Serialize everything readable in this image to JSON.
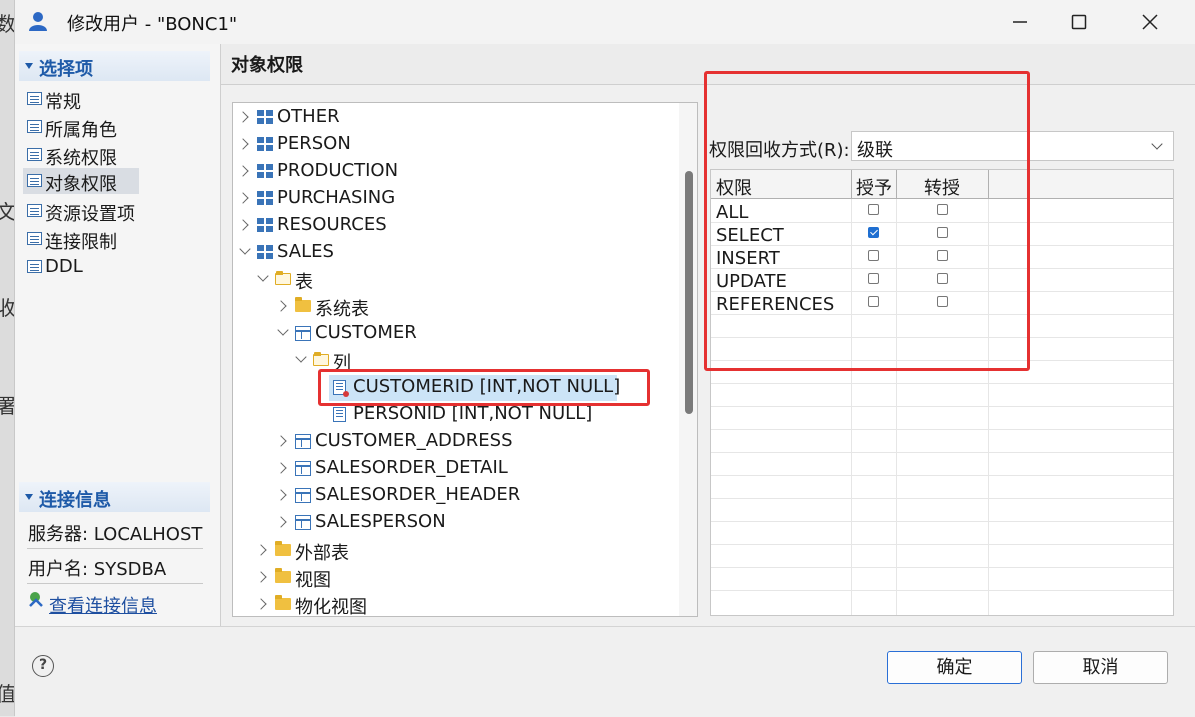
{
  "backdrop": {
    "glyphs": [
      "数",
      "文",
      "收",
      "署",
      "值"
    ]
  },
  "window": {
    "title": "修改用户 - \"BONC1\"",
    "minimize": "—",
    "maximize": "☐",
    "close": "✕"
  },
  "nav": {
    "section_title": "选择项",
    "items": [
      {
        "label": "常规"
      },
      {
        "label": "所属角色"
      },
      {
        "label": "系统权限"
      },
      {
        "label": "对象权限"
      },
      {
        "label": "资源设置项"
      },
      {
        "label": "连接限制"
      },
      {
        "label": "DDL"
      }
    ],
    "selected_index": 3,
    "conn_title": "连接信息",
    "server": "服务器: LOCALHOST",
    "username": "用户名: SYSDBA",
    "view_conn": "查看连接信息"
  },
  "main": {
    "title": "对象权限"
  },
  "tree": {
    "rows": [
      {
        "label": "OTHER",
        "icon": "schema-icon"
      },
      {
        "label": "PERSON",
        "icon": "schema-icon"
      },
      {
        "label": "PRODUCTION",
        "icon": "schema-icon"
      },
      {
        "label": "PURCHASING",
        "icon": "schema-icon"
      },
      {
        "label": "RESOURCES",
        "icon": "schema-icon"
      },
      {
        "label": "SALES",
        "icon": "schema-icon"
      },
      {
        "label": "表",
        "icon": "folder-open-icon"
      },
      {
        "label": "系统表",
        "icon": "folder-icon"
      },
      {
        "label": "CUSTOMER",
        "icon": "table-icon"
      },
      {
        "label": "列",
        "icon": "folder-open-icon"
      },
      {
        "label": "CUSTOMERID [INT,NOT NULL]",
        "icon": "key-column-icon"
      },
      {
        "label": "PERSONID [INT,NOT NULL]",
        "icon": "column-icon"
      },
      {
        "label": "CUSTOMER_ADDRESS",
        "icon": "table-icon"
      },
      {
        "label": "SALESORDER_DETAIL",
        "icon": "table-icon"
      },
      {
        "label": "SALESORDER_HEADER",
        "icon": "table-icon"
      },
      {
        "label": "SALESPERSON",
        "icon": "table-icon"
      },
      {
        "label": "外部表",
        "icon": "folder-icon"
      },
      {
        "label": "视图",
        "icon": "folder-icon"
      },
      {
        "label": "物化视图",
        "icon": "folder-icon"
      }
    ],
    "selected_index": 10
  },
  "revoke": {
    "label": "权限回收方式(R):",
    "mnemonic": "R",
    "value": "级联"
  },
  "grid": {
    "columns": [
      "权限",
      "授予",
      "转授"
    ],
    "rows": [
      {
        "privilege": "ALL",
        "grant": false,
        "regrant": false
      },
      {
        "privilege": "SELECT",
        "grant": true,
        "regrant": false
      },
      {
        "privilege": "INSERT",
        "grant": false,
        "regrant": false
      },
      {
        "privilege": "UPDATE",
        "grant": false,
        "regrant": false
      },
      {
        "privilege": "REFERENCES",
        "grant": false,
        "regrant": false
      }
    ]
  },
  "footer": {
    "help": "?",
    "ok": "确定",
    "cancel": "取消"
  },
  "colors": {
    "accent": "#1e5aa8",
    "highlight": "#e53131",
    "selection": "#cce4f7"
  }
}
